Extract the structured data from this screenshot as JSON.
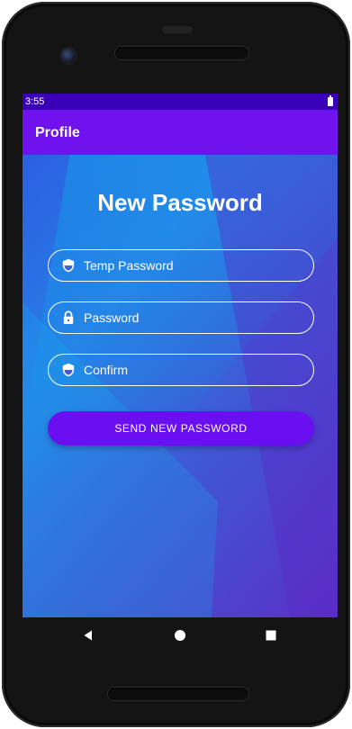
{
  "status_bar": {
    "time": "3:55"
  },
  "app_bar": {
    "title": "Profile"
  },
  "form": {
    "heading": "New Password",
    "temp_password": {
      "placeholder": "Temp Password",
      "value": "",
      "icon": "shield-icon"
    },
    "password": {
      "placeholder": "Password",
      "value": "",
      "icon": "lock-icon"
    },
    "confirm": {
      "placeholder": "Confirm",
      "value": "",
      "icon": "shield-icon"
    },
    "submit_label": "SEND NEW PASSWORD"
  },
  "navigation": {
    "back_icon": "back-triangle-icon",
    "home_icon": "home-circle-icon",
    "recents_icon": "recents-square-icon"
  },
  "colors": {
    "status_bar": "#3a00b8",
    "app_bar": "#6f12ee",
    "button": "#6a0ff0",
    "gradient_start": "#2b5fe0",
    "gradient_end": "#5b2fc6"
  }
}
